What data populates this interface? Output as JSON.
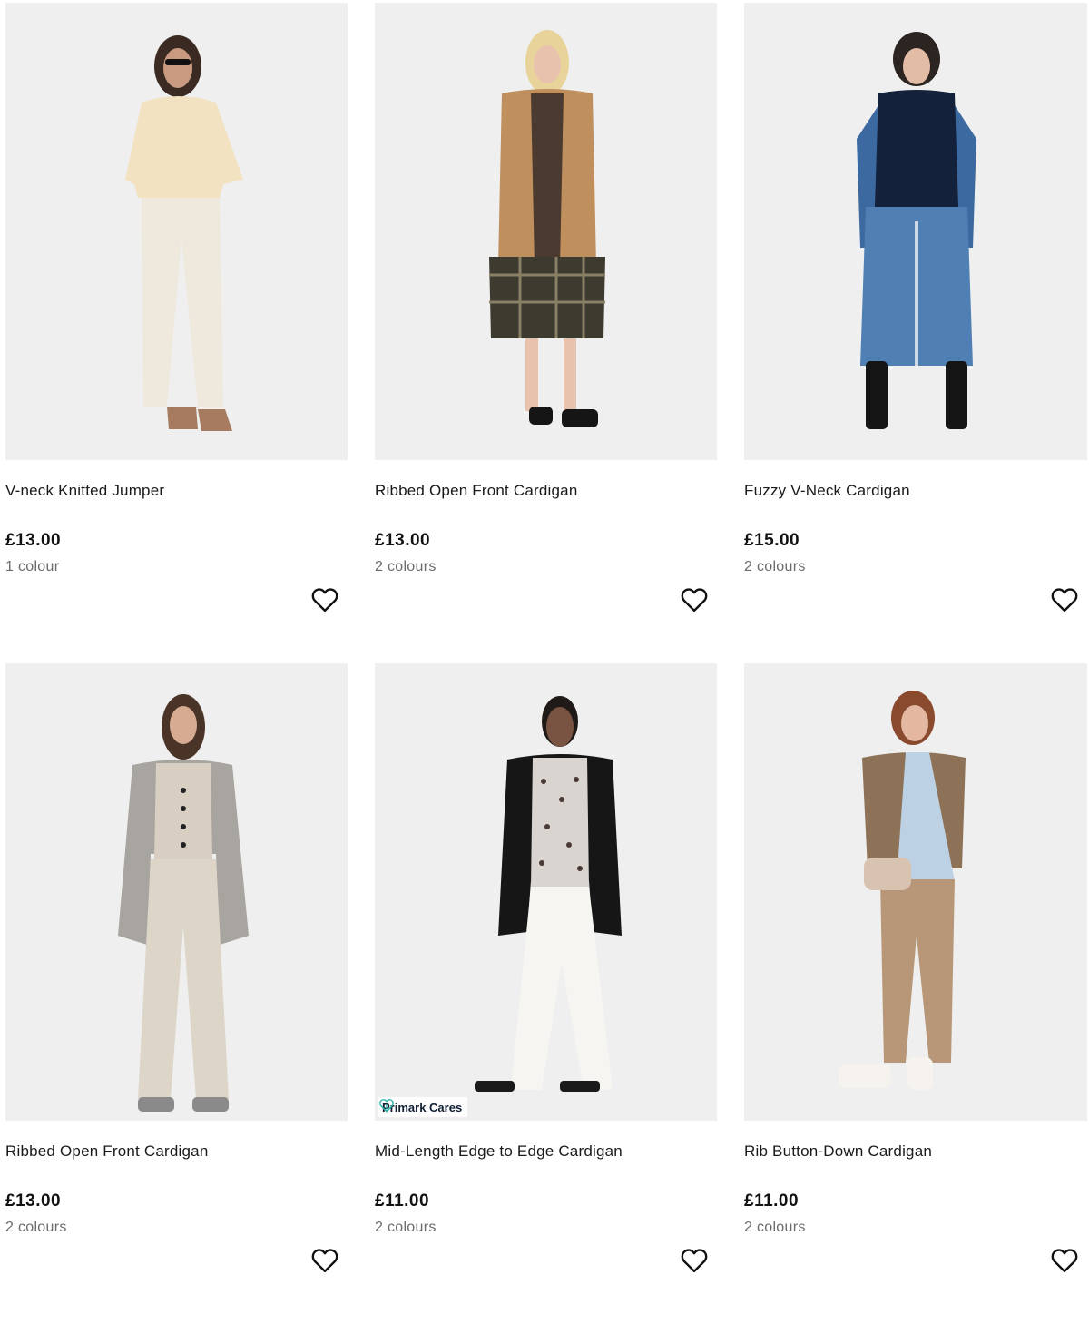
{
  "products": [
    {
      "name": "V-neck Knitted Jumper",
      "price": "£13.00",
      "colours": "1 colour",
      "badge": "",
      "image": "model-cream-jumper-photo"
    },
    {
      "name": "Ribbed Open Front Cardigan",
      "price": "£13.00",
      "colours": "2 colours",
      "badge": "",
      "image": "model-camel-cardigan-photo"
    },
    {
      "name": "Fuzzy V-Neck Cardigan",
      "price": "£15.00",
      "colours": "2 colours",
      "badge": "",
      "image": "model-navy-cardigan-photo"
    },
    {
      "name": "Ribbed Open Front Cardigan",
      "price": "£13.00",
      "colours": "2 colours",
      "badge": "",
      "image": "model-grey-cardigan-photo"
    },
    {
      "name": "Mid-Length Edge to Edge Cardigan",
      "price": "£11.00",
      "colours": "2 colours",
      "badge": "Primark Cares",
      "image": "model-black-cardigan-photo"
    },
    {
      "name": "Rib Button-Down Cardigan",
      "price": "£11.00",
      "colours": "2 colours",
      "badge": "",
      "image": "model-brown-cardigan-photo"
    }
  ],
  "icons": {
    "favourite": "heart-outline-icon",
    "badge": "heart-leaf-icon"
  },
  "colors": {
    "background": "#ffffff",
    "image_bg": "#efefef",
    "text": "#111111",
    "muted": "#6b6b6b",
    "badge_accent": "#2bb3a8"
  }
}
